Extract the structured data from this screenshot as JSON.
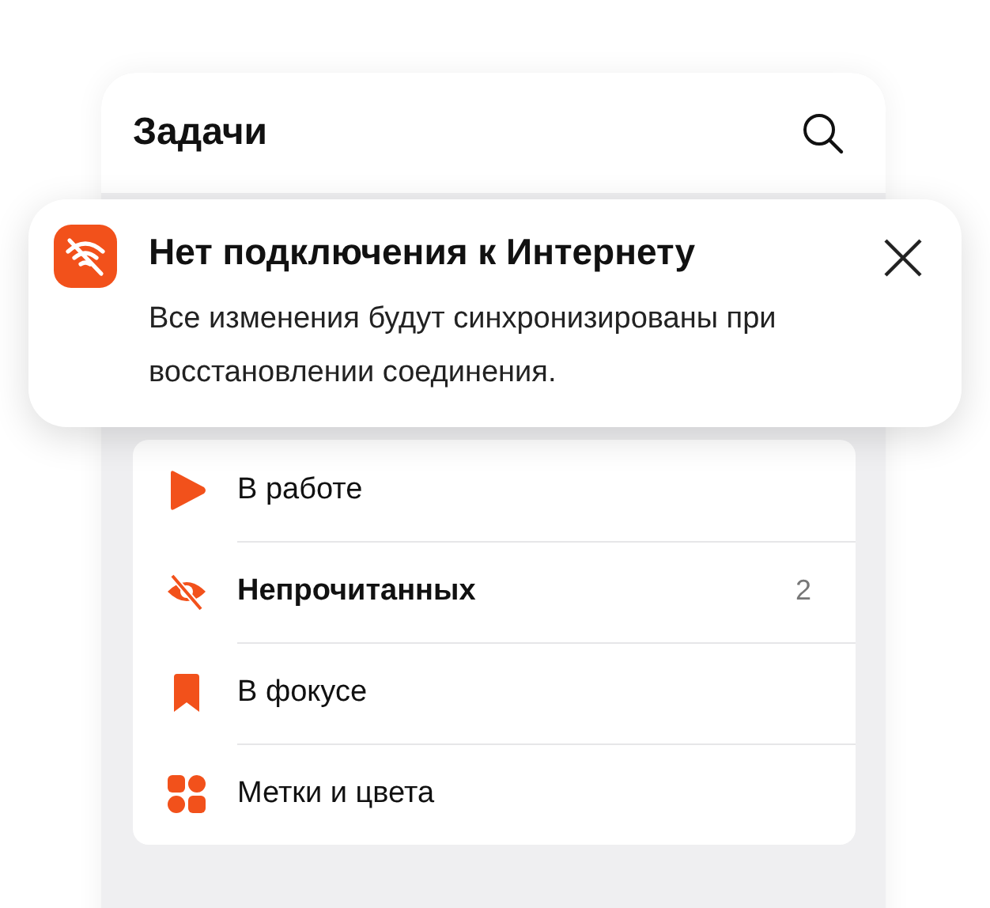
{
  "header": {
    "title": "Задачи"
  },
  "notification": {
    "title": "Нет подключения к Интернету",
    "message": "Все изменения будут синхронизированы при восстановлении соединения."
  },
  "menu": [
    {
      "kind": "play",
      "label": "В работе",
      "bold": false
    },
    {
      "kind": "eye-off",
      "label": "Непрочитанных",
      "bold": true,
      "count": "2"
    },
    {
      "kind": "bookmark",
      "label": "В фокусе",
      "bold": false
    },
    {
      "kind": "tags",
      "label": "Метки и цвета",
      "bold": false
    }
  ]
}
